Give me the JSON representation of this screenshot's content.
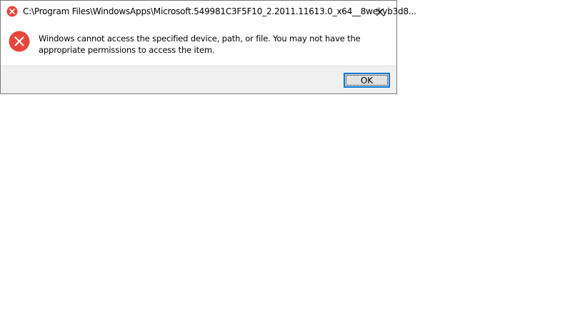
{
  "dialog": {
    "title": "C:\\Program Files\\WindowsApps\\Microsoft.549981C3F5F10_2.2011.11613.0_x64__8wekyb3d8...",
    "message": "Windows cannot access the specified device, path, or file. You may not have the appropriate permissions to access the item.",
    "ok_label": "OK",
    "title_icon": "error-icon",
    "message_icon": "error-icon",
    "close_icon": "close-icon"
  },
  "colors": {
    "error_red": "#e81123",
    "accent": "#0078d7",
    "footer_bg": "#f0f0f0"
  }
}
